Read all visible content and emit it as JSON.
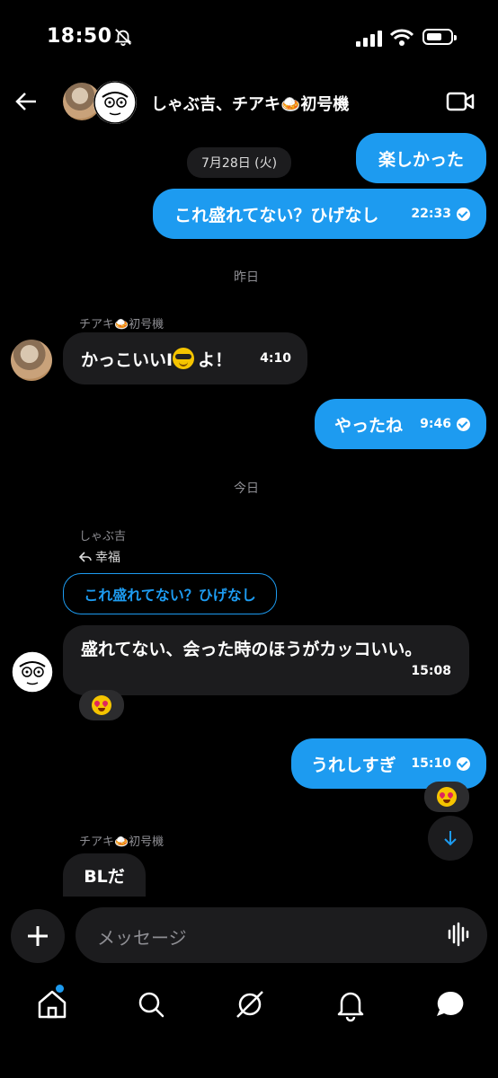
{
  "status": {
    "time": "18:50"
  },
  "header": {
    "title": "しゃぶ吉、チアキ🍛初号機"
  },
  "date_pills": {
    "first": "7月28日 (火)",
    "yesterday": "昨日",
    "today": "今日"
  },
  "messages": [
    {
      "dir": "out",
      "text": "楽しかった"
    },
    {
      "dir": "out",
      "text": "これ盛れてない？ひげなし",
      "time": "22:33"
    },
    {
      "dir": "in",
      "sender": "チアキ🍛初号機",
      "text_before": "かっこいいI",
      "text_after": "よ！",
      "time": "4:10"
    },
    {
      "dir": "out",
      "text": "やったね",
      "time": "9:46"
    },
    {
      "dir": "in",
      "sender": "しゃぶ吉",
      "reply_label": "幸福",
      "quoted": "これ盛れてない？ひげなし",
      "text": "盛れてない、会った時のほうがカッコいい。",
      "time": "15:08"
    },
    {
      "dir": "out",
      "text": "うれしすぎ",
      "time": "15:10"
    },
    {
      "dir": "in",
      "sender": "チアキ🍛初号機",
      "text": "BLだ"
    }
  ],
  "composer": {
    "placeholder": "メッセージ"
  },
  "icons": [
    "back-arrow-icon",
    "video-icon",
    "mute-bell-icon",
    "plus-icon",
    "waveform-icon",
    "home-icon",
    "search-icon",
    "grok-icon",
    "notifications-icon",
    "messages-icon",
    "arrow-down-icon"
  ],
  "colors": {
    "accent": "#1d9bf0",
    "bubble_in": "#1c1c1e",
    "background": "#000000"
  }
}
